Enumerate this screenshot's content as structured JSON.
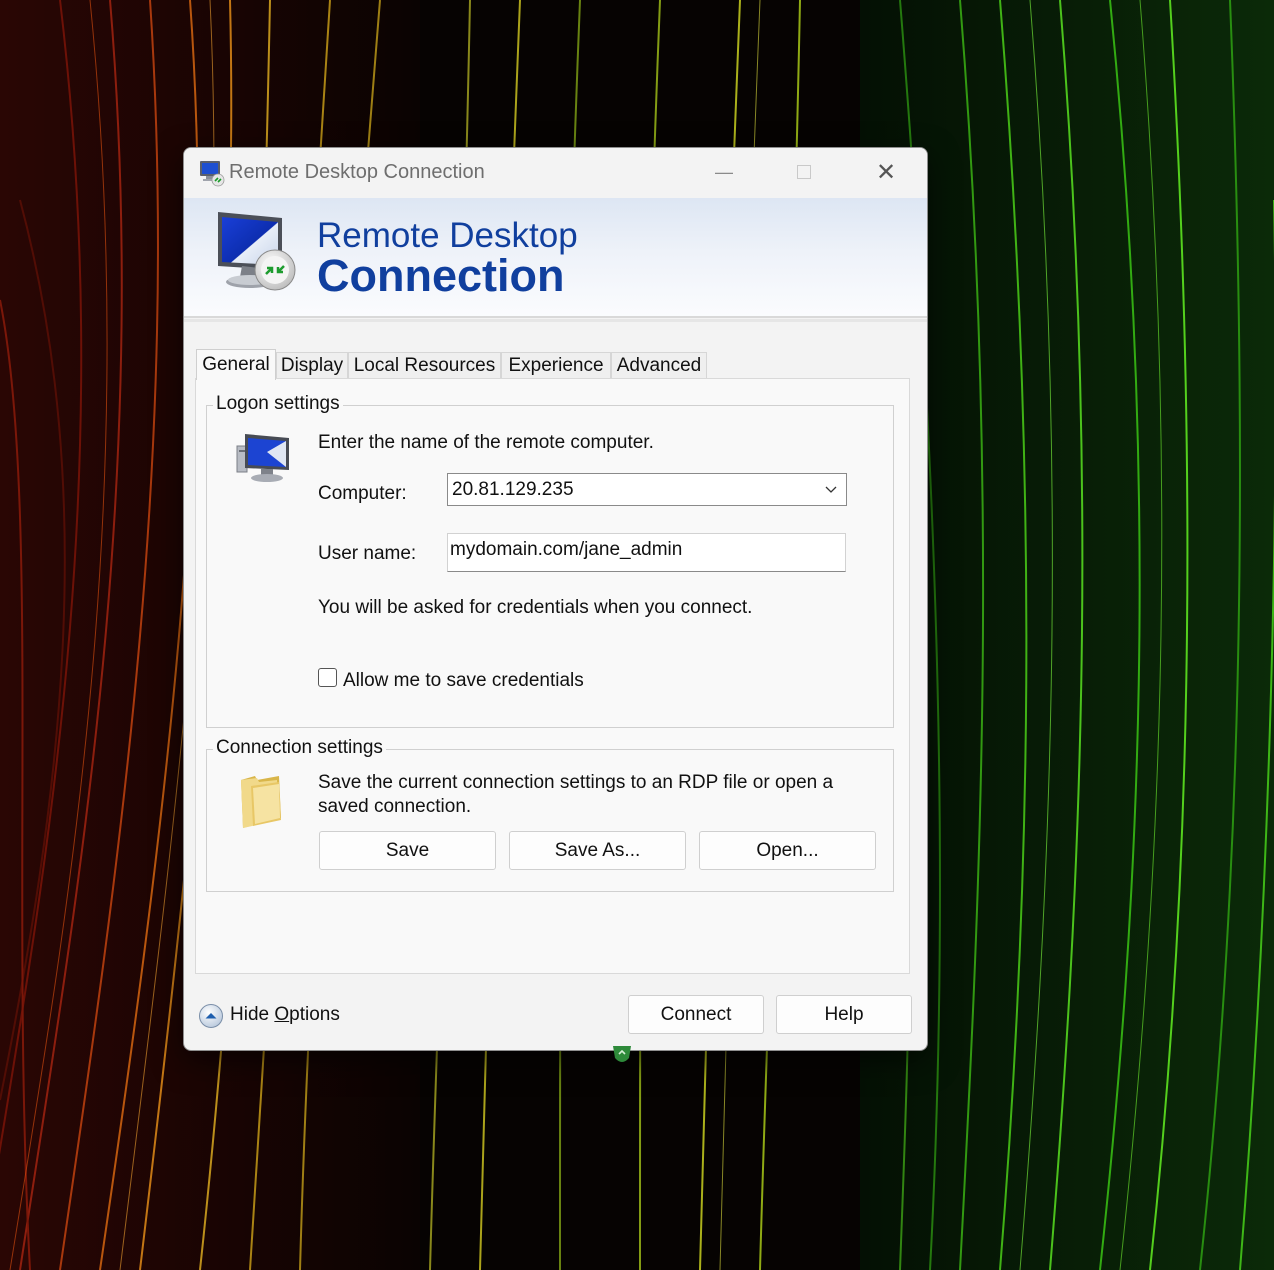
{
  "window": {
    "title": "Remote Desktop Connection",
    "minimize_glyph": "—",
    "close_glyph": "✕"
  },
  "banner": {
    "line1": "Remote Desktop",
    "line2": "Connection",
    "text_color": "#103f9e"
  },
  "tabs": [
    {
      "label": "General",
      "active": true
    },
    {
      "label": "Display",
      "active": false
    },
    {
      "label": "Local Resources",
      "active": false
    },
    {
      "label": "Experience",
      "active": false
    },
    {
      "label": "Advanced",
      "active": false
    }
  ],
  "logon": {
    "legend": "Logon settings",
    "instruction": "Enter the name of the remote computer.",
    "computer_label": "Computer:",
    "computer_value": "20.81.129.235",
    "username_label": "User name:",
    "username_value": "mydomain.com/jane_admin",
    "credentials_note": "You will be asked for credentials when you connect.",
    "save_credentials_label": "Allow me to save credentials",
    "save_credentials_checked": false
  },
  "connection": {
    "legend": "Connection settings",
    "description_line1": "Save the current connection settings to an RDP file or open a",
    "description_line2": "saved connection.",
    "save_label": "Save",
    "save_as_label": "Save As...",
    "open_label": "Open..."
  },
  "footer": {
    "hide_options_prefix": "Hide ",
    "hide_options_underlined": "O",
    "hide_options_suffix": "ptions",
    "connect_label": "Connect",
    "help_label": "Help"
  },
  "icons": {
    "app": "remote-desktop-icon",
    "banner": "monitor-remote-icon",
    "logon": "computer-icon",
    "connection": "folder-icon",
    "hide_options": "chevron-up-circle-icon",
    "tray": "tray-app-icon"
  }
}
